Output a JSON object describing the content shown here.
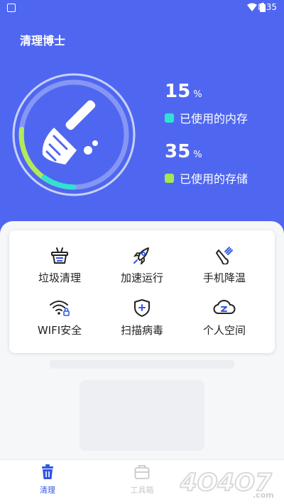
{
  "status_bar": {
    "time": "8:35"
  },
  "header": {
    "title": "清理博士"
  },
  "stats": [
    {
      "value": "15",
      "unit": "%",
      "label": "已使用的内存",
      "color": "#2ee3d0"
    },
    {
      "value": "35",
      "unit": "%",
      "label": "已使用的存储",
      "color": "#a6e651"
    }
  ],
  "tools": [
    {
      "label": "垃圾清理",
      "icon": "basket-icon"
    },
    {
      "label": "加速运行",
      "icon": "rocket-icon"
    },
    {
      "label": "手机降温",
      "icon": "thermometer-icon"
    },
    {
      "label": "WIFI安全",
      "icon": "wifi-lock-icon"
    },
    {
      "label": "扫描病毒",
      "icon": "shield-plus-icon"
    },
    {
      "label": "个人空间",
      "icon": "cloud-z-icon"
    }
  ],
  "tabs": [
    {
      "label": "清理",
      "icon": "trash-icon",
      "active": true
    },
    {
      "label": "工具箱",
      "icon": "toolbox-icon",
      "active": false
    }
  ],
  "watermark": {
    "text": "4O4O7.com"
  },
  "colors": {
    "primary": "#4f67f0",
    "accent": "#2f57e6",
    "tab_inactive": "#c9c9c9"
  }
}
